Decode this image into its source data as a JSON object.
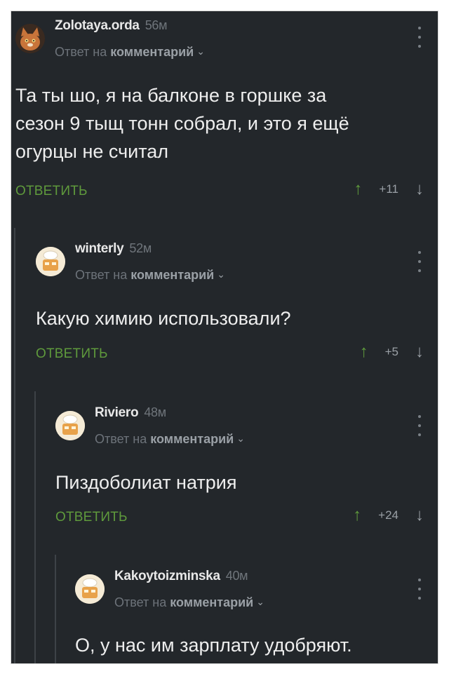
{
  "comments": [
    {
      "author": "Zolotaya.orda",
      "time": "56м",
      "reply_prefix": "Ответ на",
      "reply_target": "комментарий",
      "text_lines": [
        "Та ты шо, я на балконе в горшке за",
        "сезон 9 тыщ тонн собрал, и это я ещё",
        "огурцы не считал"
      ],
      "reply_label": "ОТВЕТИТЬ",
      "score": "+11",
      "avatar": "cat-avatar"
    },
    {
      "author": "winterly",
      "time": "52м",
      "reply_prefix": "Ответ на",
      "reply_target": "комментарий",
      "text_lines": [
        "Какую химию использовали?"
      ],
      "reply_label": "ОТВЕТИТЬ",
      "score": "+5",
      "avatar": "chef-avatar"
    },
    {
      "author": "Riviero",
      "time": "48м",
      "reply_prefix": "Ответ на",
      "reply_target": "комментарий",
      "text_lines": [
        "Пиздоболиат натрия"
      ],
      "reply_label": "ОТВЕТИТЬ",
      "score": "+24",
      "avatar": "chef-avatar"
    },
    {
      "author": "Kakoytoizminska",
      "time": "40м",
      "reply_prefix": "Ответ на",
      "reply_target": "комментарий",
      "text_lines": [
        "О, у нас им зарплату удобряют."
      ],
      "avatar": "chef-avatar"
    }
  ],
  "colors": {
    "background": "#23272b",
    "accent_green": "#5f9a3c",
    "text": "#eeeeee",
    "muted": "#6d737a"
  }
}
